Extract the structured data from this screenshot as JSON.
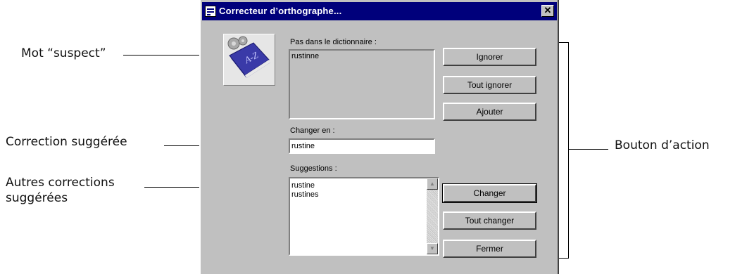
{
  "annotations": {
    "suspect_word": "Mot “suspect”",
    "suggested_correction": "Correction suggérée",
    "other_corrections_line1": "Autres corrections",
    "other_corrections_line2": "suggérées",
    "action_button": "Bouton d’action"
  },
  "dialog": {
    "title": "Correcteur d’orthographe...",
    "close_glyph": "✕",
    "not_in_dictionary_label": "Pas dans le dictionnaire :",
    "not_in_dictionary_word": "rustinne",
    "change_to_label": "Changer en :",
    "change_to_value": "rustine",
    "suggestions_label": "Suggestions :",
    "suggestions": [
      "rustine",
      "rustines"
    ],
    "buttons": {
      "ignore": "Ignorer",
      "ignore_all": "Tout ignorer",
      "add": "Ajouter",
      "change": "Changer",
      "change_all": "Tout changer",
      "close": "Fermer"
    },
    "book_icon_text": "A-Z"
  },
  "colors": {
    "titlebar": "#00007b",
    "window": "#c0c0c0",
    "book": "#3a3aa8"
  }
}
